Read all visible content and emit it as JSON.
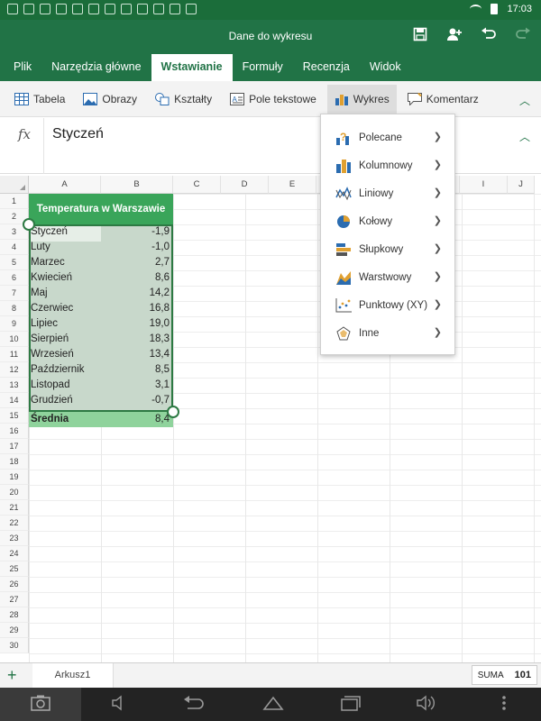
{
  "status": {
    "time": "17:03"
  },
  "window": {
    "title": "Dane do wykresu"
  },
  "tabs": [
    "Plik",
    "Narzędzia główne",
    "Wstawianie",
    "Formuły",
    "Recenzja",
    "Widok"
  ],
  "active_tab": "Wstawianie",
  "ribbon": {
    "items": [
      {
        "label": "Tabela",
        "icon": "table-icon"
      },
      {
        "label": "Obrazy",
        "icon": "image-icon"
      },
      {
        "label": "Kształty",
        "icon": "shapes-icon"
      },
      {
        "label": "Pole tekstowe",
        "icon": "textbox-icon"
      },
      {
        "label": "Wykres",
        "icon": "chart-icon"
      },
      {
        "label": "Komentarz",
        "icon": "comment-icon"
      }
    ]
  },
  "formula_bar": {
    "fx": "fx",
    "value": "Styczeń"
  },
  "columns": [
    "A",
    "B",
    "C",
    "D",
    "E",
    "F",
    "G",
    "H",
    "I",
    "J"
  ],
  "rows": [
    "1",
    "2",
    "3",
    "4",
    "5",
    "6",
    "7",
    "8",
    "9",
    "10",
    "11",
    "12",
    "13",
    "14",
    "15",
    "16",
    "17",
    "18",
    "19",
    "20",
    "21",
    "22",
    "23",
    "24",
    "25",
    "26",
    "27",
    "28",
    "29",
    "30"
  ],
  "sheet": {
    "title": "Temperatura w Warszawie",
    "data": [
      {
        "month": "Styczeń",
        "value": "-1,9"
      },
      {
        "month": "Luty",
        "value": "-1,0"
      },
      {
        "month": "Marzec",
        "value": "2,7"
      },
      {
        "month": "Kwiecień",
        "value": "8,6"
      },
      {
        "month": "Maj",
        "value": "14,2"
      },
      {
        "month": "Czerwiec",
        "value": "16,8"
      },
      {
        "month": "Lipiec",
        "value": "19,0"
      },
      {
        "month": "Sierpień",
        "value": "18,3"
      },
      {
        "month": "Wrzesień",
        "value": "13,4"
      },
      {
        "month": "Październik",
        "value": "8,5"
      },
      {
        "month": "Listopad",
        "value": "3,1"
      },
      {
        "month": "Grudzień",
        "value": "-0,7"
      }
    ],
    "average": {
      "label": "Średnia",
      "value": "8,4"
    }
  },
  "chart_menu": {
    "items": [
      {
        "label": "Polecane",
        "icon": "recommended-chart-icon"
      },
      {
        "label": "Kolumnowy",
        "icon": "column-chart-icon"
      },
      {
        "label": "Liniowy",
        "icon": "line-chart-icon"
      },
      {
        "label": "Kołowy",
        "icon": "pie-chart-icon"
      },
      {
        "label": "Słupkowy",
        "icon": "bar-chart-icon"
      },
      {
        "label": "Warstwowy",
        "icon": "area-chart-icon"
      },
      {
        "label": "Punktowy (XY)",
        "icon": "scatter-chart-icon"
      },
      {
        "label": "Inne",
        "icon": "other-chart-icon"
      }
    ]
  },
  "sheet_tabs": [
    "Arkusz1"
  ],
  "status_summary": {
    "label": "SUMA",
    "value": "101"
  },
  "colors": {
    "accent": "#217346",
    "title_fill": "#3aa55a",
    "selection": "#c8d8cb",
    "average_fill": "#8fd39c"
  }
}
